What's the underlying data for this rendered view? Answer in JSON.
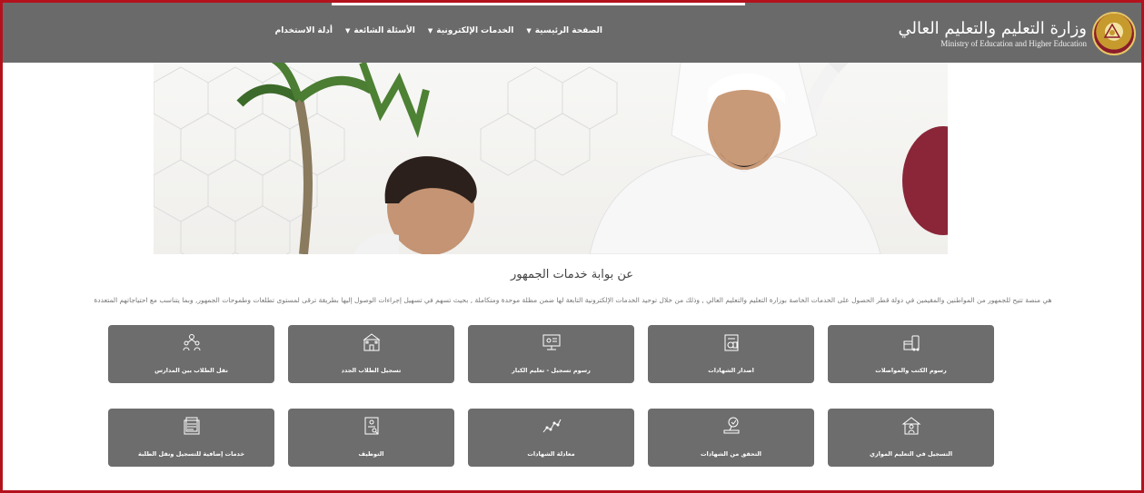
{
  "header": {
    "logo_ar": "وزارة التعليم والتعليم العالي",
    "logo_en": "Ministry of Education and Higher Education",
    "nav": [
      {
        "label": "الصفحة الرئيسية",
        "has_caret": true
      },
      {
        "label": "الخدمات الإلكترونية",
        "has_caret": true
      },
      {
        "label": "الأسئلة الشائعة",
        "has_caret": true
      },
      {
        "label": "أدلة الاستخدام",
        "has_caret": false
      }
    ]
  },
  "main": {
    "title": "عن بوابة خدمات الجمهور",
    "description": "هي منصة تتيح للجمهور من المواطنين والمقيمين في دولة قطر الحصول على الخدمات الخاصة بوزارة التعليم والتعليم العالي , وذلك من خلال توحيد الخدمات الإلكترونية التابعة لها ضمن مظلة موحدة ومتكاملة , بحيث تسهم في تسهيل إجراءات الوصول إليها بطريقة ترقى لمستوى تطلعات وطموحات الجمهور, وبما يتناسب مع احتياجاتهم المتعددة"
  },
  "services_row1": [
    {
      "label": "رسوم الكتب والمواصلات",
      "icon": "books-bus-icon"
    },
    {
      "label": "اصدار الشهادات",
      "icon": "certificate-icon"
    },
    {
      "label": "رسوم تسجيل - تعليم الكبار",
      "icon": "computer-icon"
    },
    {
      "label": "تسجيل الطلاب الجدد",
      "icon": "school-icon"
    },
    {
      "label": "نقل الطلاب بين المدارس",
      "icon": "students-icon"
    }
  ],
  "services_row2": [
    {
      "label": "التسجيل في التعليم الموازي",
      "icon": "house-person-icon"
    },
    {
      "label": "التحقق من الشهادات",
      "icon": "stamp-icon"
    },
    {
      "label": "معادلة الشهادات",
      "icon": "chart-line-icon"
    },
    {
      "label": "التوظيف",
      "icon": "cv-search-icon"
    },
    {
      "label": "خدمات إضافية للتسجيل ونقل الطلبة",
      "icon": "document-stack-icon"
    }
  ],
  "colors": {
    "header_bg": "#6b6a6a",
    "tile_bg": "#6e6d6d",
    "border": "#b3121d",
    "accent": "#8a2638"
  }
}
